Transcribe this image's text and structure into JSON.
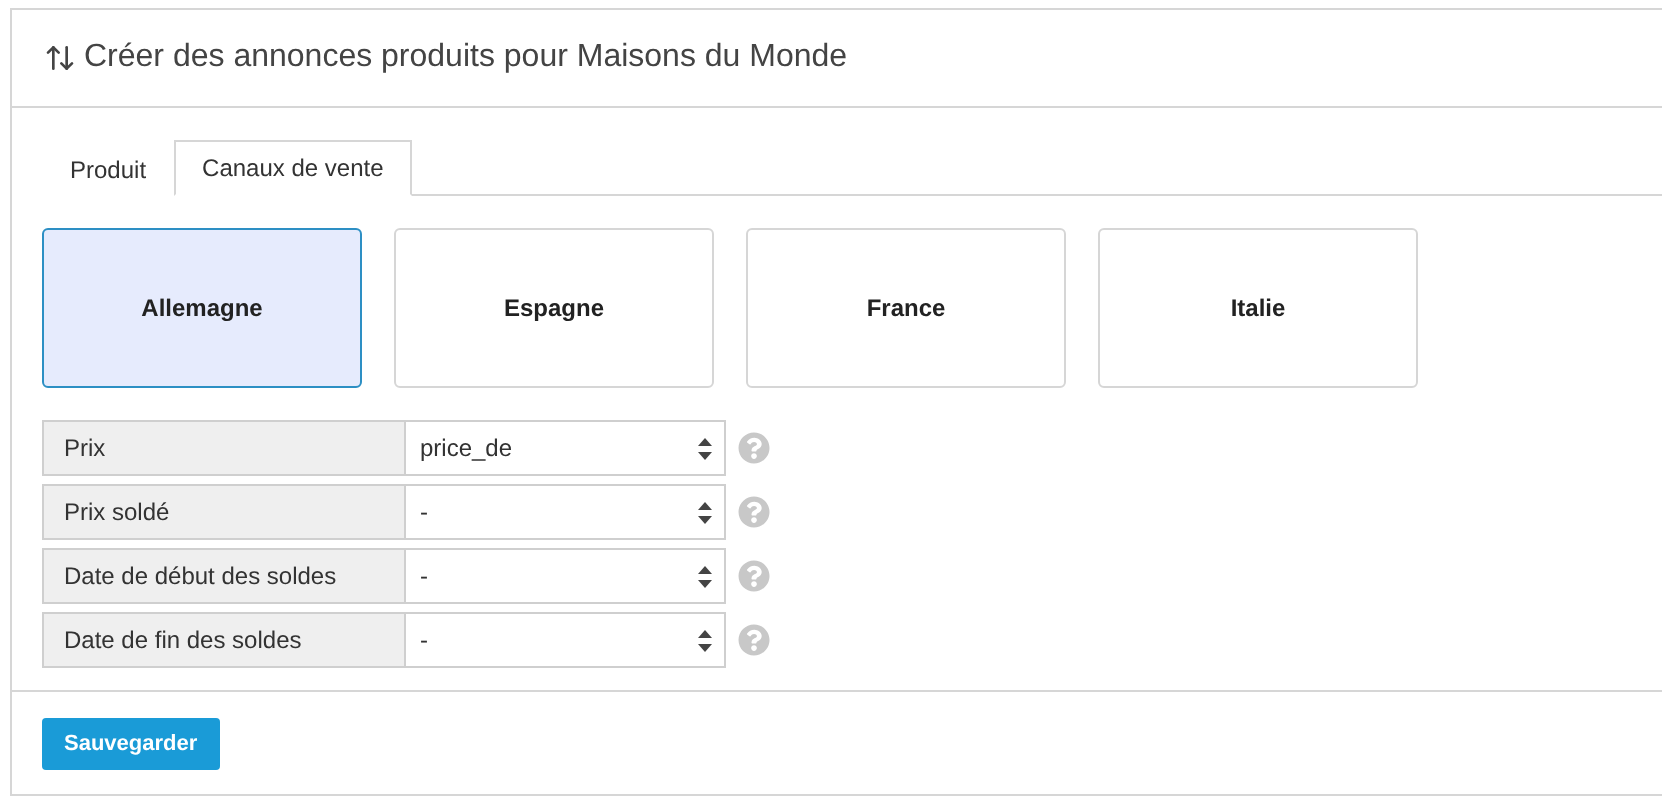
{
  "header": {
    "title": "Créer des annonces produits pour Maisons du Monde"
  },
  "tabs": [
    {
      "label": "Produit",
      "selected": false
    },
    {
      "label": "Canaux de vente",
      "selected": true
    }
  ],
  "channels": [
    {
      "label": "Allemagne",
      "selected": true
    },
    {
      "label": "Espagne",
      "selected": false
    },
    {
      "label": "France",
      "selected": false
    },
    {
      "label": "Italie",
      "selected": false
    }
  ],
  "fields": [
    {
      "label": "Prix",
      "value": "price_de"
    },
    {
      "label": "Prix soldé",
      "value": "-"
    },
    {
      "label": "Date de début des soldes",
      "value": "-"
    },
    {
      "label": "Date de fin des soldes",
      "value": "-"
    }
  ],
  "save_button": "Sauvegarder"
}
